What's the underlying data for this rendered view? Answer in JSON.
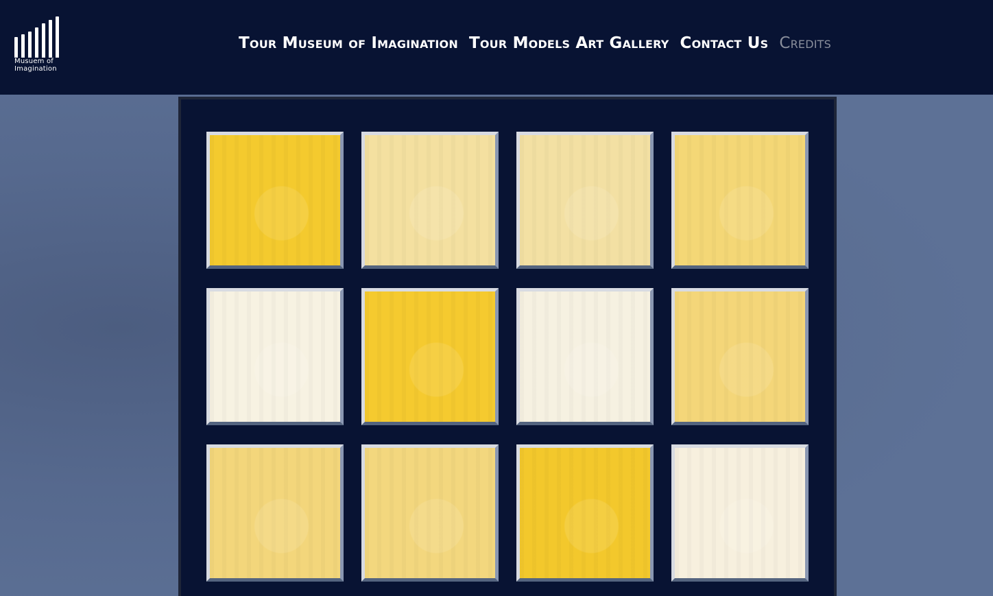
{
  "logo": {
    "text": "Musuem of\nImagination",
    "bars": [
      30,
      34,
      38,
      44,
      50,
      55,
      60
    ]
  },
  "nav": {
    "items": [
      {
        "label": "Tour Museum of Imagination",
        "active": true
      },
      {
        "label": "Tour Models Art Gallery",
        "active": true
      },
      {
        "label": "Contact Us",
        "active": true
      },
      {
        "label": "Credits",
        "active": false
      }
    ]
  },
  "colors": {
    "header_bg": "#081333",
    "board_bg": "#081333",
    "tile_bright": "#f3c931",
    "tile_medium": "#f2d77a",
    "tile_light": "#f3e2a0",
    "tile_cream": "#f7f1e0"
  },
  "board": {
    "rows": 3,
    "cols": 4,
    "tiles": [
      {
        "color": "#f4ca2e"
      },
      {
        "color": "#f4e0a0"
      },
      {
        "color": "#f3e0a3"
      },
      {
        "color": "#f4d776"
      },
      {
        "color": "#f7f2e2"
      },
      {
        "color": "#f5ca2f"
      },
      {
        "color": "#f6f1e1"
      },
      {
        "color": "#f4d679"
      },
      {
        "color": "#f3d67b"
      },
      {
        "color": "#f3d77e"
      },
      {
        "color": "#f3c82c"
      },
      {
        "color": "#f7f0de"
      }
    ]
  }
}
